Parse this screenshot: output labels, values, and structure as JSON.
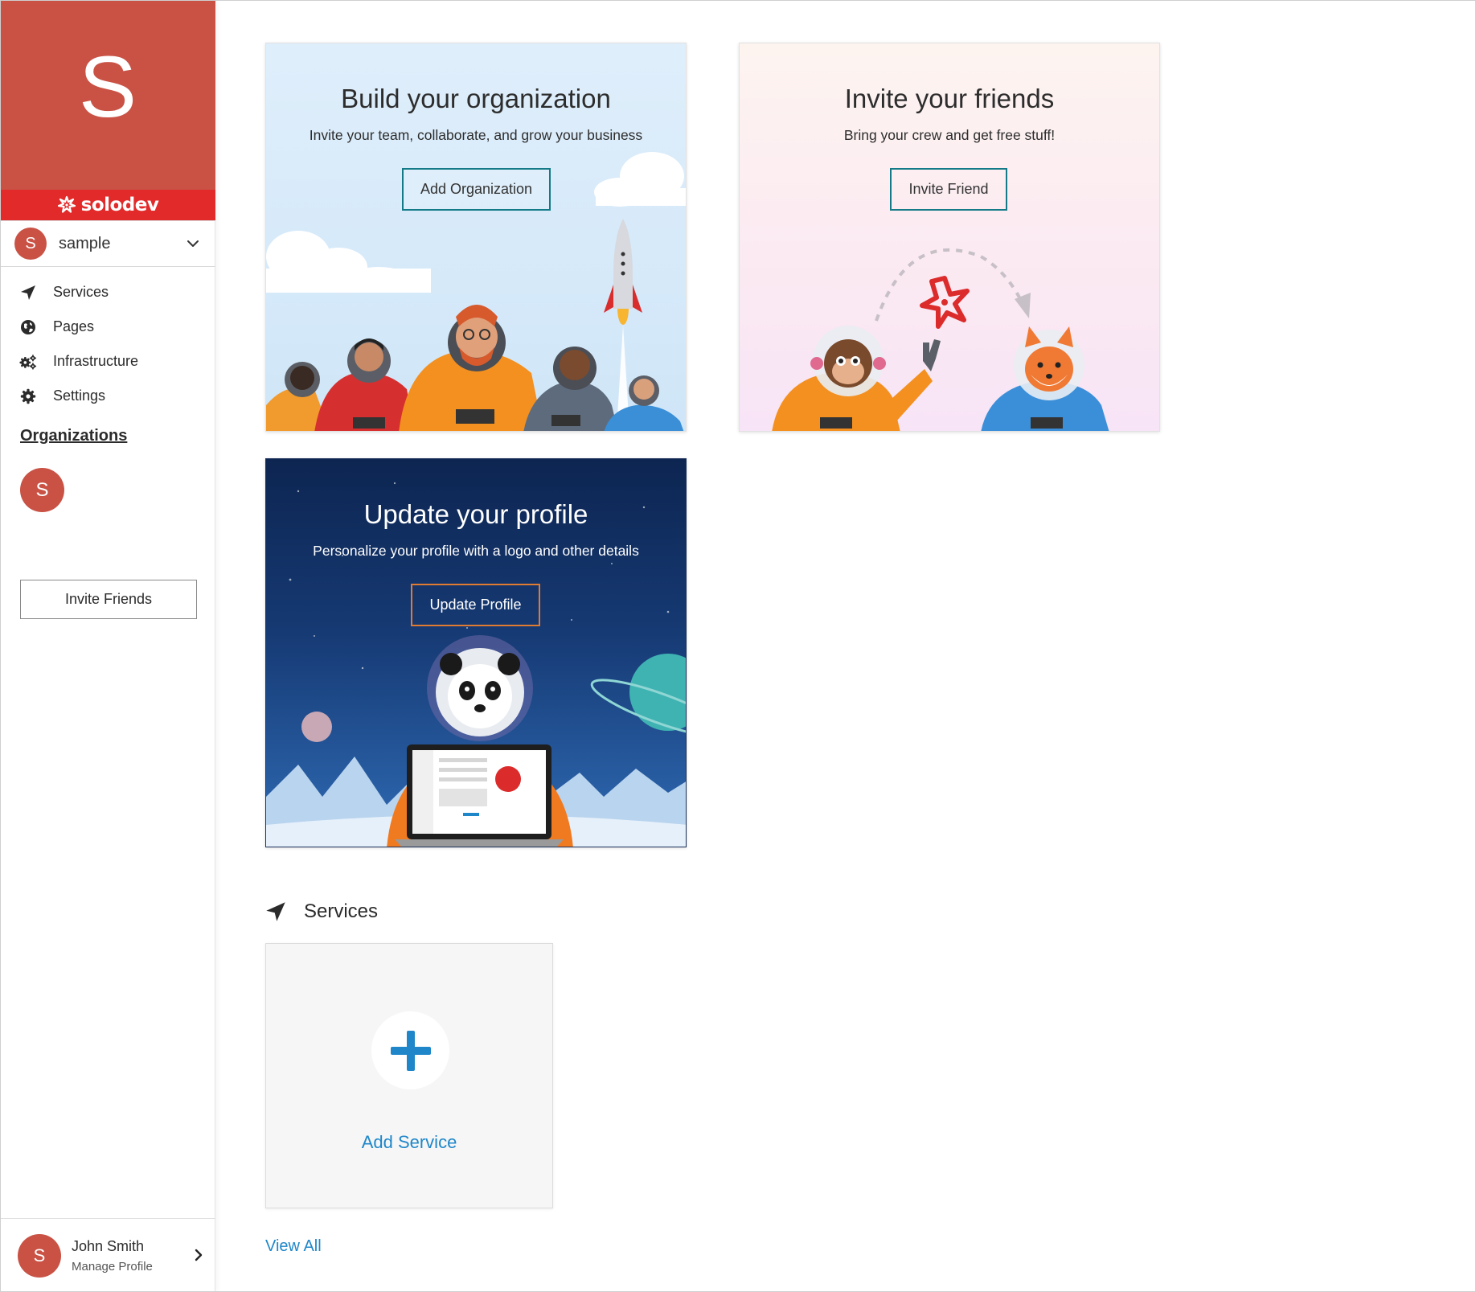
{
  "colors": {
    "org_red": "#c95245",
    "brand_red": "#e22a2a",
    "teal_button": "#147a87",
    "orange_button": "#e07b32",
    "link_blue": "#1f87c9"
  },
  "sidebar": {
    "org_initial": "S",
    "brand_name": "solodev",
    "org_switcher": {
      "initial": "S",
      "label": "sample",
      "icon": "chevron-down-icon"
    },
    "nav_items": [
      {
        "label": "Services",
        "icon": "paper-plane-icon"
      },
      {
        "label": "Pages",
        "icon": "globe-icon"
      },
      {
        "label": "Infrastructure",
        "icon": "gears-icon"
      },
      {
        "label": "Settings",
        "icon": "gear-icon"
      }
    ],
    "organizations_heading": "Organizations",
    "organizations": [
      {
        "initial": "S"
      }
    ],
    "invite_friends_label": "Invite Friends",
    "user": {
      "initial": "S",
      "name": "John Smith",
      "subtitle": "Manage Profile",
      "icon": "chevron-right-icon"
    }
  },
  "cards": {
    "organization": {
      "title": "Build your organization",
      "subtitle": "Invite your team, collaborate, and grow your business",
      "button_label": "Add Organization"
    },
    "invite": {
      "title": "Invite your friends",
      "subtitle": "Bring your crew and get free stuff!",
      "button_label": "Invite Friend"
    },
    "profile": {
      "title": "Update your profile",
      "subtitle": "Personalize your profile with a logo and other details",
      "button_label": "Update Profile"
    }
  },
  "services": {
    "heading": "Services",
    "icon": "paper-plane-icon",
    "add_label": "Add Service",
    "add_icon": "plus-icon",
    "view_all_label": "View All"
  }
}
